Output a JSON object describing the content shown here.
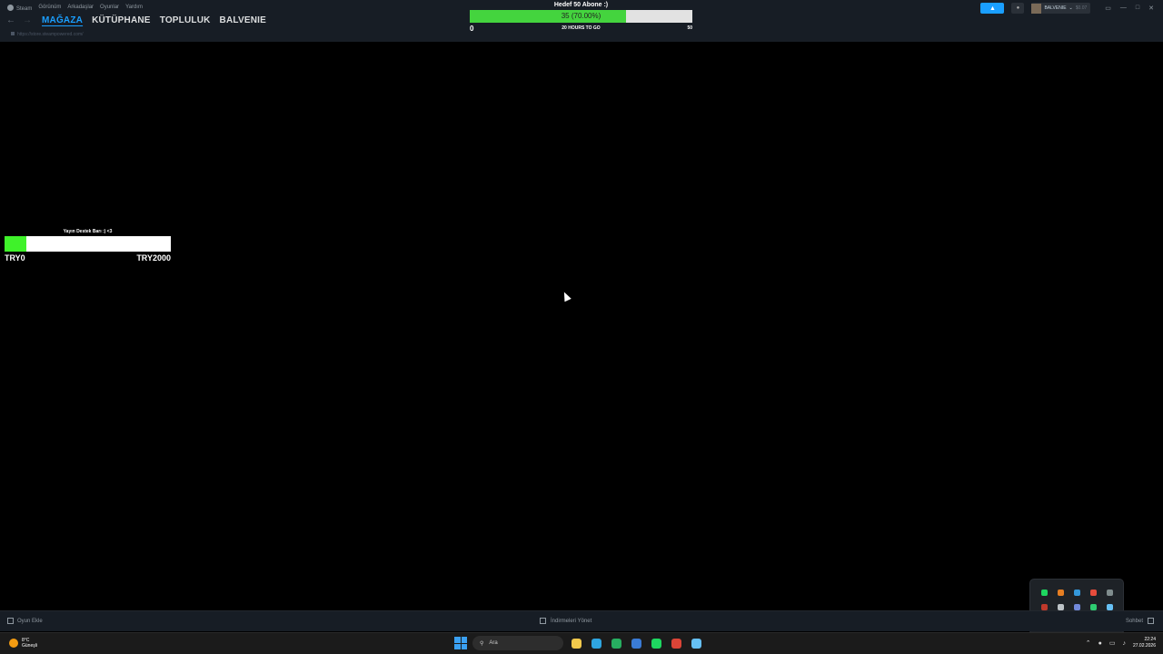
{
  "menubar": {
    "items": [
      "Steam",
      "Görünüm",
      "Arkadaşlar",
      "Oyunlar",
      "Yardım"
    ]
  },
  "nav": {
    "links": [
      "MAĞAZA",
      "KÜTÜPHANE",
      "TOPLULUK",
      "BALVENIE"
    ],
    "active": 0,
    "url": "https://store.steampowered.com/"
  },
  "goal_widget": {
    "title": "Hedef 50 Abone :)",
    "current": 35,
    "target": 50,
    "progress": 0.7,
    "percent_label": "35 (70.00%)",
    "min_label": "0",
    "max_label": "50",
    "time_left": "20 HOURS TO GO",
    "fill_color": "#44d43e"
  },
  "account": {
    "name": "BALVENIE",
    "balance": "$0.07"
  },
  "donation_widget": {
    "title": "Yayın Destek Barı :) <3",
    "min_label": "TRY0",
    "max_label": "TRY2000",
    "progress": 0.13,
    "fill_color": "#3ff22a"
  },
  "steam_bottom": {
    "add_game": "Oyun Ekle",
    "downloads": "İndirmeleri Yönet",
    "chat": "Sohbet"
  },
  "taskbar": {
    "weather_temp": "8°C",
    "weather_desc": "Güneşli",
    "search_placeholder": "Ara",
    "time": "22:24",
    "date": "27.02.2026",
    "apps": [
      {
        "name": "file-explorer-icon",
        "color": "#f2c94c"
      },
      {
        "name": "edge-icon",
        "color": "#2fa5e0"
      },
      {
        "name": "xbox-icon",
        "color": "#27ae60"
      },
      {
        "name": "store-icon",
        "color": "#3a7bd5"
      },
      {
        "name": "spotify-icon",
        "color": "#1ed760"
      },
      {
        "name": "chrome-icon",
        "color": "#db4437"
      },
      {
        "name": "steam-icon",
        "color": "#66c0f4"
      }
    ]
  },
  "tray_popup_icons": [
    {
      "name": "spotify-tray-icon",
      "color": "#1ed760"
    },
    {
      "name": "app-tray-icon-orange",
      "color": "#e67e22"
    },
    {
      "name": "app-tray-icon-blue",
      "color": "#3498db"
    },
    {
      "name": "chrome-tray-icon",
      "color": "#e74c3c"
    },
    {
      "name": "app-tray-icon-gray",
      "color": "#7f8c8d"
    },
    {
      "name": "app-tray-icon-red",
      "color": "#c0392b"
    },
    {
      "name": "app-tray-icon-white",
      "color": "#bdc3c7"
    },
    {
      "name": "discord-tray-icon",
      "color": "#7289da"
    },
    {
      "name": "play-tray-icon",
      "color": "#2ecc71"
    },
    {
      "name": "steam-tray-icon",
      "color": "#66c0f4"
    },
    {
      "name": "mic-tray-icon",
      "color": "#e74c3c"
    },
    {
      "name": "xbox-tray-icon",
      "color": "#27ae60"
    },
    {
      "name": "app-tray-icon-teal",
      "color": "#1abc9c"
    },
    {
      "name": "nvidia-tray-icon",
      "color": "#76b900"
    }
  ]
}
